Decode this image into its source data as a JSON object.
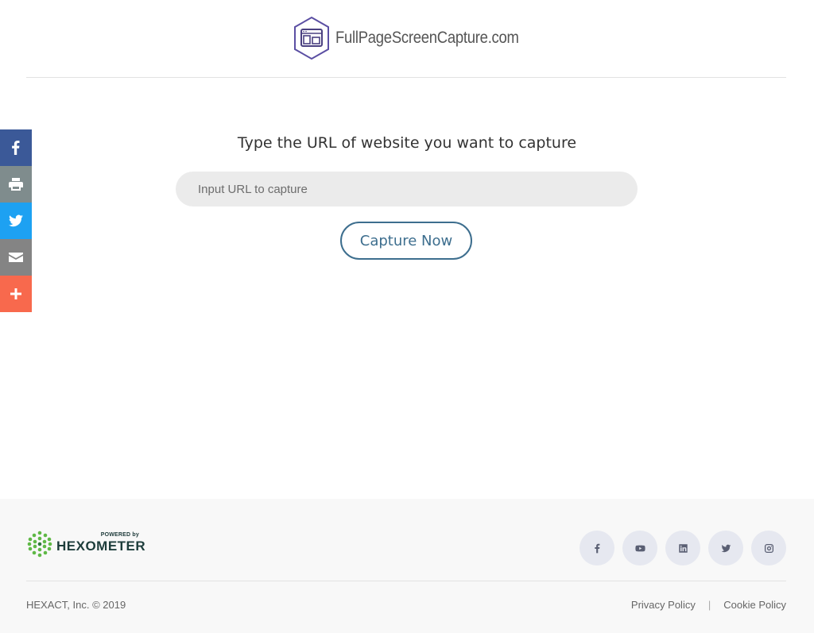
{
  "header": {
    "logo_text": "FullPageScreenCapture.com",
    "logo_icon": "browser-window-hex-icon",
    "brand_color": "#5b4fa3"
  },
  "share_bar": {
    "items": [
      {
        "name": "facebook",
        "icon": "facebook-icon",
        "color": "#3b5998"
      },
      {
        "name": "print",
        "icon": "printer-icon",
        "color": "#7f8c8d"
      },
      {
        "name": "twitter",
        "icon": "twitter-icon",
        "color": "#1da1f2"
      },
      {
        "name": "email",
        "icon": "email-icon",
        "color": "#848484"
      },
      {
        "name": "more",
        "icon": "plus-icon",
        "color": "#f8694d"
      }
    ]
  },
  "main": {
    "headline": "Type the URL of website you want to capture",
    "url_input": {
      "placeholder": "Input URL to capture",
      "value": ""
    },
    "capture_button": "Capture Now",
    "accent_color": "#3d6e8e"
  },
  "footer": {
    "powered_by": "POWERED by",
    "brand": "HEXOMETER",
    "socials": [
      "facebook-icon",
      "youtube-icon",
      "linkedin-icon",
      "twitter-icon",
      "instagram-icon"
    ],
    "copyright": "HEXACT, Inc. © 2019",
    "links": {
      "privacy": "Privacy Policy",
      "separator": "|",
      "cookie": "Cookie Policy"
    }
  }
}
